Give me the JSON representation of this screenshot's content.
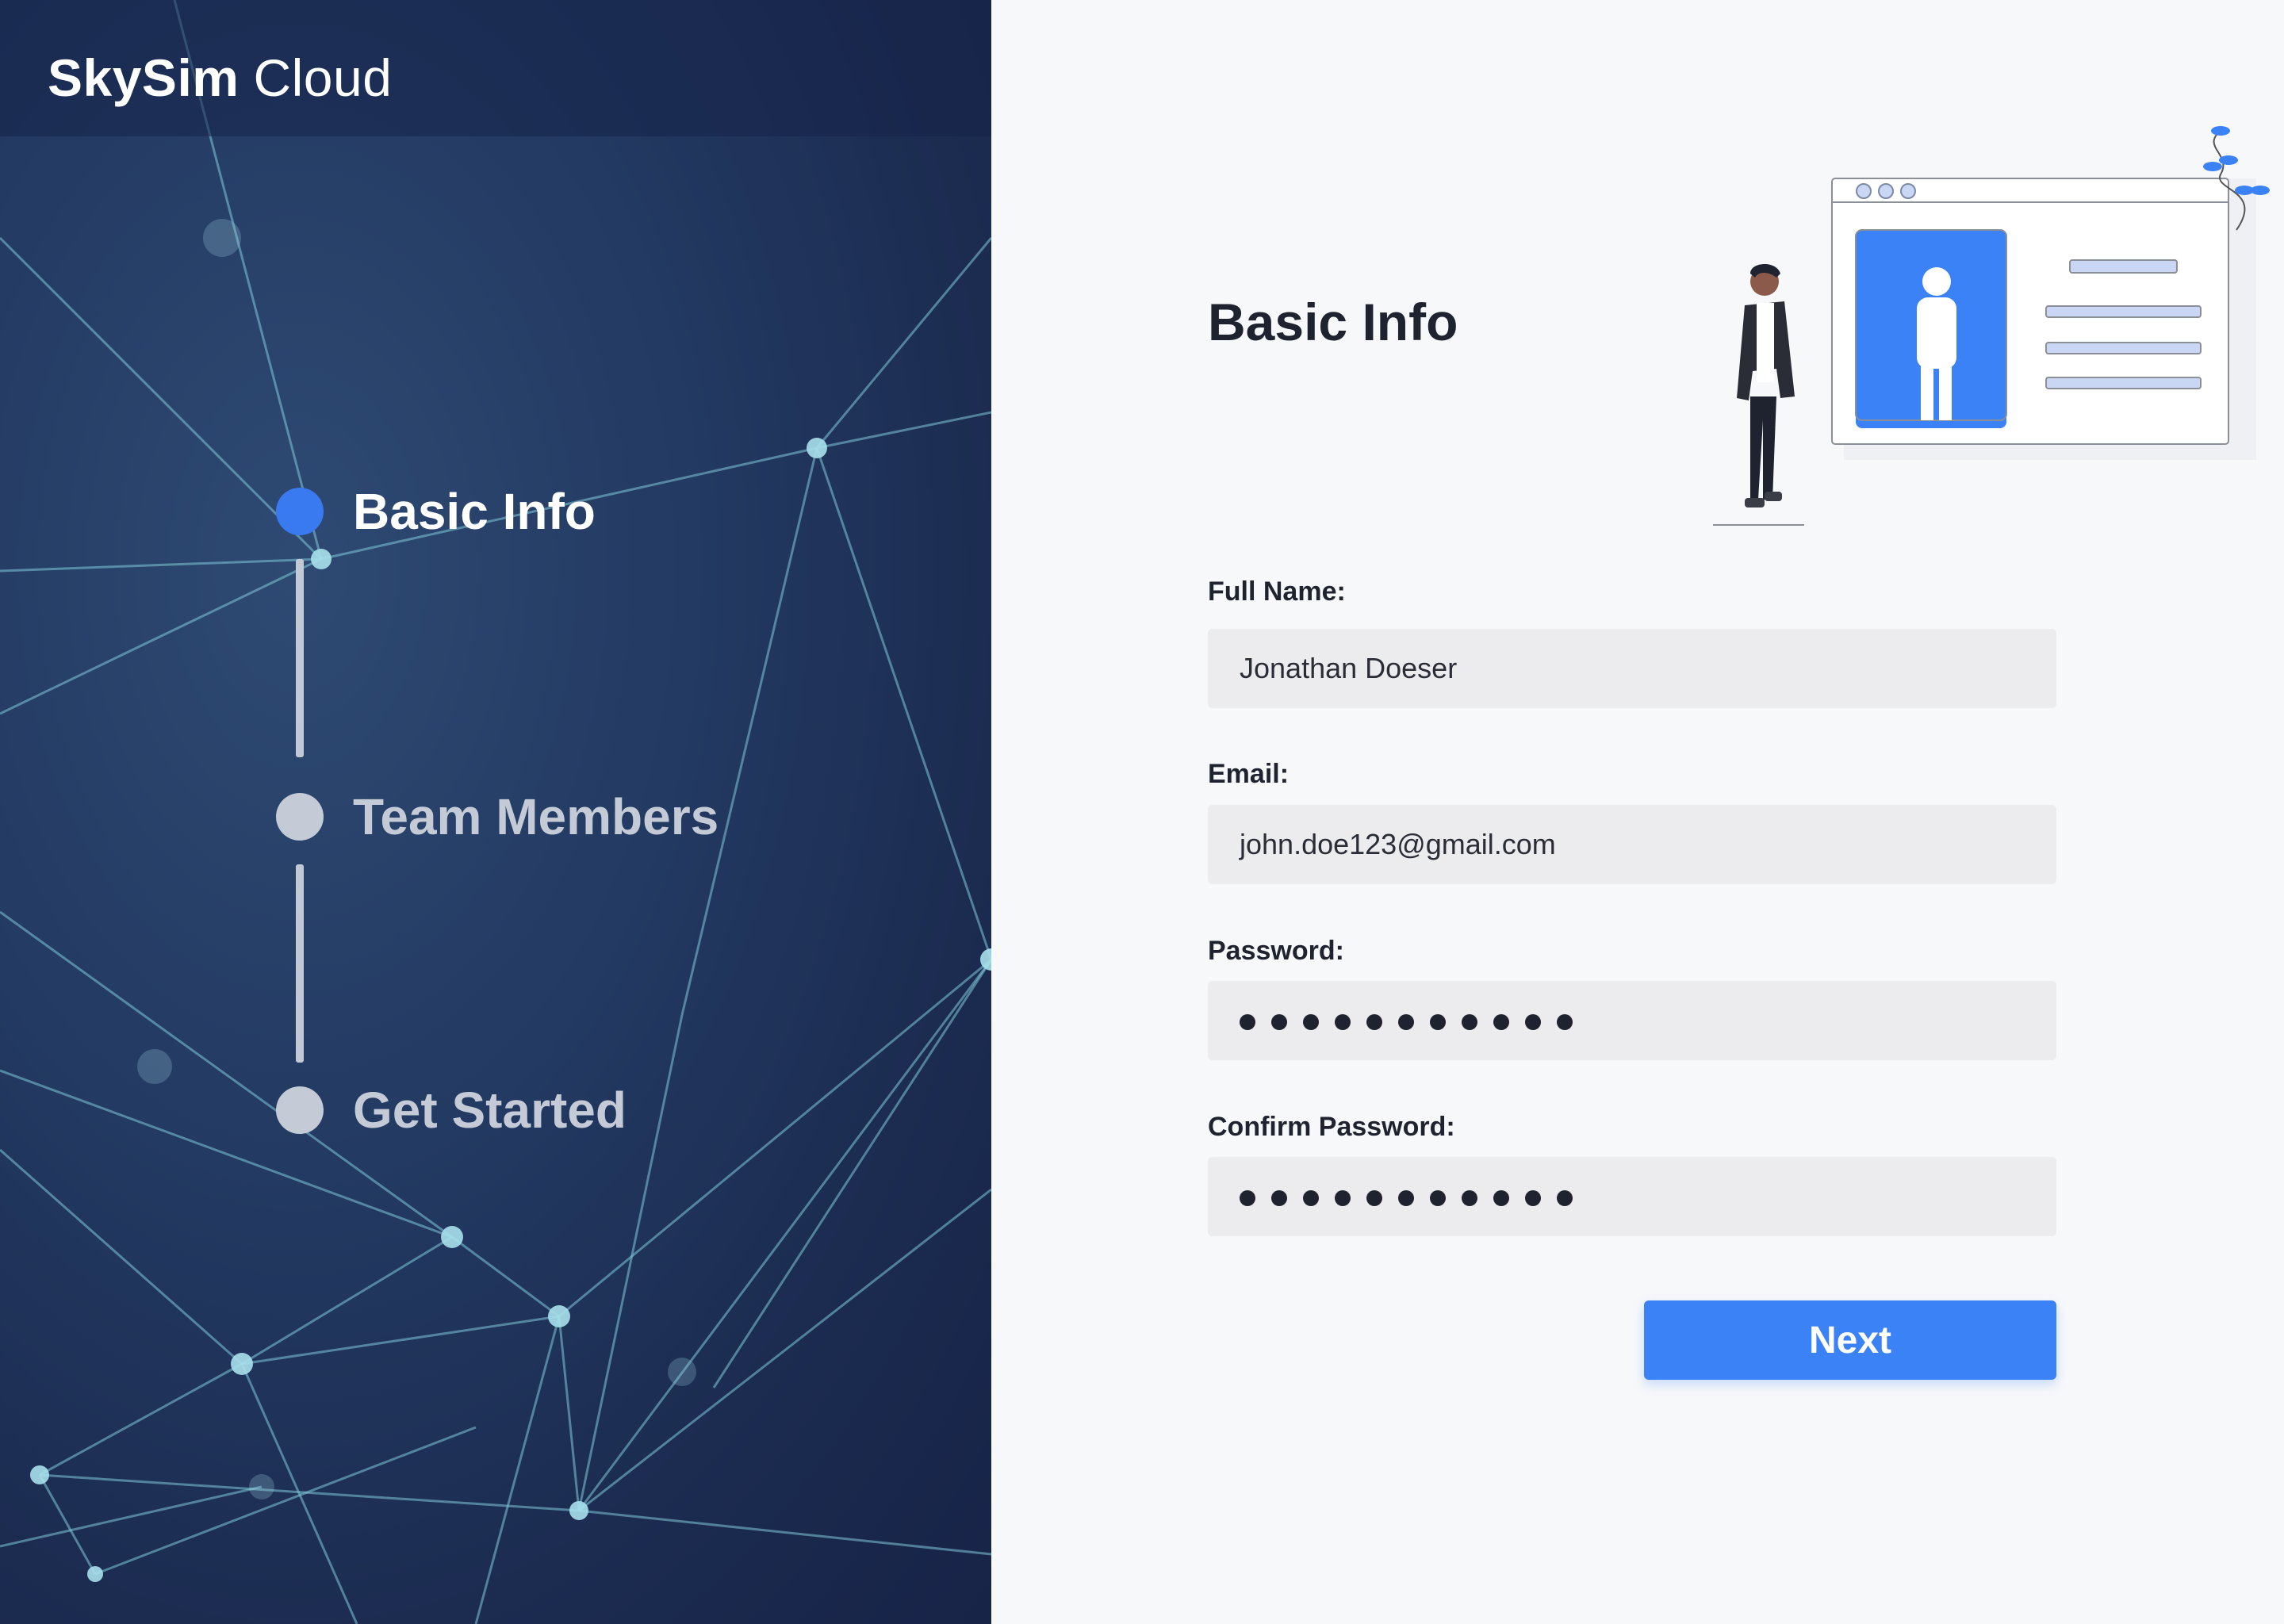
{
  "app": {
    "brand_bold": "SkySim",
    "brand_light": "Cloud"
  },
  "steps": [
    {
      "label": "Basic Info",
      "state": "active"
    },
    {
      "label": "Team Members",
      "state": "inactive"
    },
    {
      "label": "Get Started",
      "state": "inactive"
    }
  ],
  "form": {
    "title": "Basic Info",
    "fields": [
      {
        "label": "Full Name:",
        "value": "Jonathan Doeser"
      },
      {
        "label": "Email:",
        "value": "john.doe123@gmail.com"
      },
      {
        "label": "Password:",
        "masked_length": 11
      },
      {
        "label": "Confirm Password:",
        "masked_length": 11
      }
    ],
    "next_label": "Next"
  },
  "colors": {
    "accent": "#3b82f6",
    "panel_dark": "#1b2a4f",
    "page_bg": "#f7f8fa"
  },
  "icons": {
    "illustration": "profile-illustration"
  }
}
